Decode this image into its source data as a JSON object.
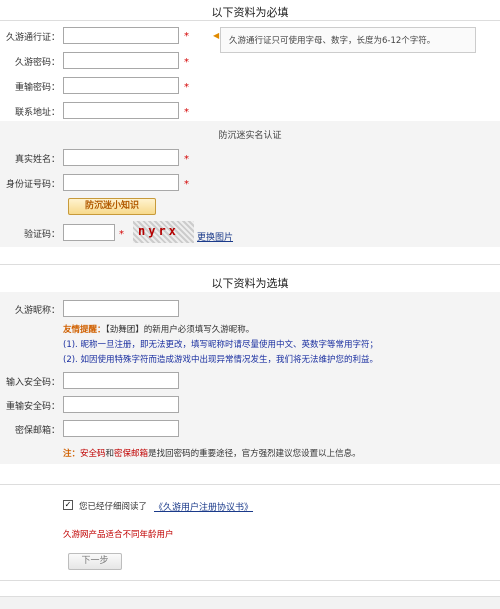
{
  "required_section": {
    "title": "以下资料为必填",
    "fields": {
      "passport_label": "久游通行证：",
      "password_label": "久游密码：",
      "repassword_label": "重输密码：",
      "address_label": "联系地址："
    },
    "tip": "久游通行证只可使用字母、数字，长度为6-12个字符。",
    "required_mark": "*"
  },
  "realname_section": {
    "title": "防沉迷实名认证",
    "realname_label": "真实姓名：",
    "idcard_label": "身份证号码：",
    "knowledge_button": "防沉迷小知识",
    "captcha_label": "验证码：",
    "captcha_text": "nyrx",
    "refresh_link": "更换图片"
  },
  "optional_section": {
    "title": "以下资料为选填",
    "nickname_label": "久游昵称：",
    "friendly_tip_prefix": "友情提醒：",
    "friendly_tip_text": "【劲舞团】的新用户必须填写久游昵称。",
    "note1": "(1). 昵称一旦注册，即无法更改，填写昵称时请尽量使用中文、英数字等常用字符；",
    "note2": "(2). 如因使用特殊字符而造成游戏中出现异常情况发生，我们将无法维护您的利益。",
    "security_code_label": "输入安全码：",
    "re_security_code_label": "重输安全码：",
    "secure_email_label": "密保邮箱：",
    "note_prefix": "注：",
    "note_kw1": "安全码",
    "note_and": "和",
    "note_kw2": "密保邮箱",
    "note_rest": "是找回密码的重要途径，官方强烈建议您设置以上信息。"
  },
  "agreement": {
    "checked": true,
    "text": "您已经仔细阅读了",
    "link": "《久游用户注册协议书》",
    "age_notice": "久游网产品适合不同年龄用户",
    "next_button": "下一步"
  }
}
